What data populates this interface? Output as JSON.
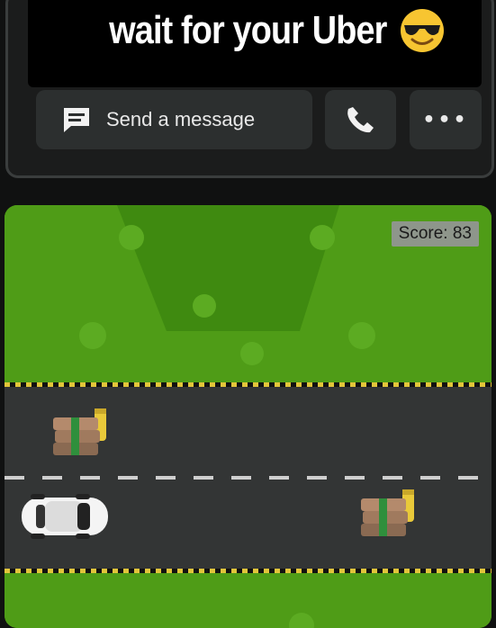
{
  "banner": {
    "headline": "wait for your Uber",
    "emoji_icon": "smiling-face-with-sunglasses-icon"
  },
  "actions": {
    "message_label": "Send a message",
    "message_icon": "message-icon",
    "call_icon": "phone-icon",
    "more_label": "•••",
    "more_icon": "more-dots-icon"
  },
  "game": {
    "score_label": "Score: 83",
    "colors": {
      "grass": "#4f9c17",
      "road": "#333535",
      "score_bg": "#8e968b"
    },
    "sprites": [
      "tree-icon",
      "cash-stack-icon",
      "car-icon"
    ]
  }
}
